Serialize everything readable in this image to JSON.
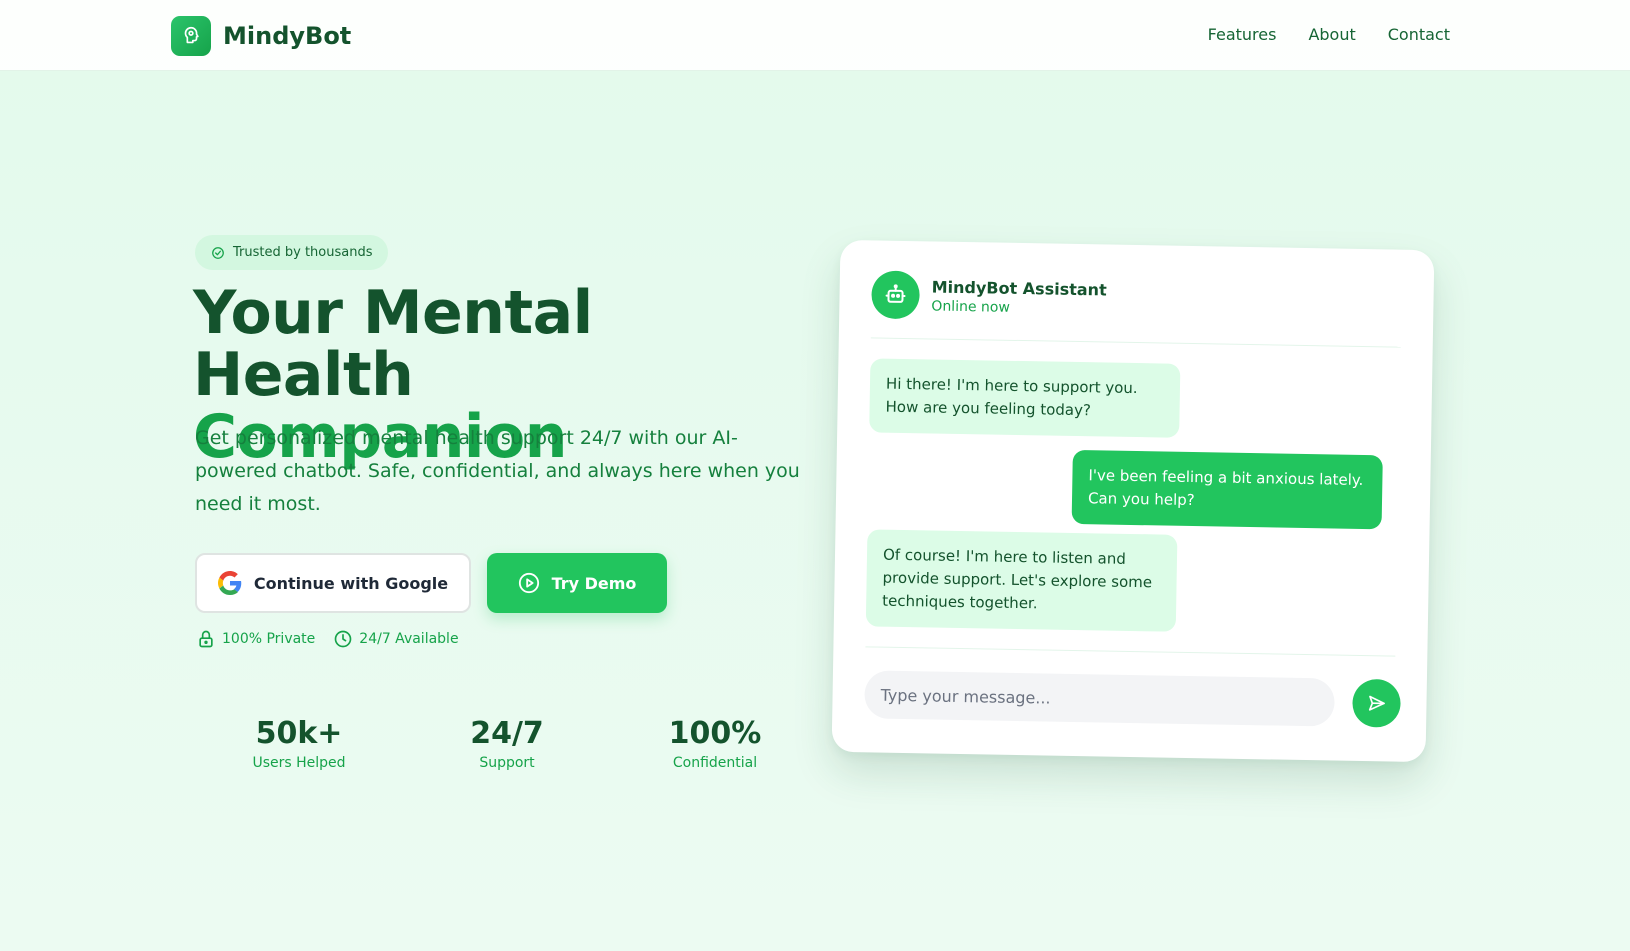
{
  "nav": {
    "brand": "MindyBot",
    "links": [
      "Features",
      "About",
      "Contact"
    ]
  },
  "hero": {
    "badge": "Trusted by thousands",
    "title_line1": "Your Mental Health",
    "title_line2": "Companion",
    "description": "Get personalized mental health support 24/7 with our AI-powered chatbot. Safe, confidential, and always here when you need it most.",
    "google_button": "Continue with Google",
    "demo_button": "Try Demo",
    "features": [
      "100% Private",
      "24/7 Available"
    ]
  },
  "stats": [
    {
      "value": "50k+",
      "label": "Users Helped"
    },
    {
      "value": "24/7",
      "label": "Support"
    },
    {
      "value": "100%",
      "label": "Confidential"
    }
  ],
  "chat": {
    "assistant_name": "MindyBot Assistant",
    "status": "Online now",
    "messages": [
      {
        "from": "bot",
        "text": "Hi there! I'm here to support you. How are you feeling today?"
      },
      {
        "from": "user",
        "text": "I've been feeling a bit anxious lately. Can you help?"
      },
      {
        "from": "bot",
        "text": "Of course! I'm here to listen and provide support. Let's explore some techniques together."
      }
    ],
    "input_placeholder": "Type your message..."
  },
  "colors": {
    "primary": "#22c55e",
    "dark": "#14532d",
    "accent_text": "#16a34a",
    "background": "#e6f9ee"
  },
  "icons": {
    "brand": "brain-head-icon",
    "badge": "check-circle-icon",
    "google": "google-icon",
    "demo": "play-circle-icon",
    "private": "lock-icon",
    "available": "clock-icon",
    "bot": "robot-icon",
    "send": "send-icon"
  }
}
